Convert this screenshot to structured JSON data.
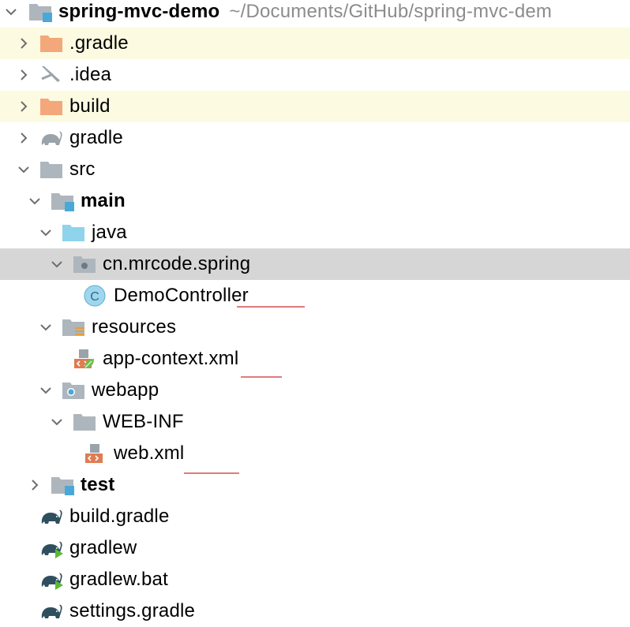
{
  "project": {
    "name": "spring-mvc-demo",
    "path": "~/Documents/GitHub/spring-mvc-dem"
  },
  "tree": {
    "gradle_dir": ".gradle",
    "idea_dir": ".idea",
    "build_dir": "build",
    "gradle_folder": "gradle",
    "src": "src",
    "main": "main",
    "java": "java",
    "package": "cn.mrcode.spring",
    "demo_controller": "DemoController",
    "resources": "resources",
    "app_context": "app-context.xml",
    "webapp": "webapp",
    "web_inf": "WEB-INF",
    "web_xml": "web.xml",
    "test": "test",
    "build_gradle": "build.gradle",
    "gradlew": "gradlew",
    "gradlew_bat": "gradlew.bat",
    "settings_gradle": "settings.gradle"
  },
  "icons": {
    "folder_excluded": "folder-orange",
    "folder_plain": "folder-gray",
    "source_root": "folder-blue",
    "class": "class-c-icon",
    "gradle": "elephant-icon"
  },
  "colors": {
    "excluded_folder": "#f4a77a",
    "folder": "#aeb6bd",
    "source_folder": "#8fd3ec",
    "row_highlight": "#fcfbe2",
    "row_selected": "#d6d6d6",
    "squiggle": "#e07b7b",
    "elephant": "#2f4f5e"
  },
  "icon_glyphs": {
    "class_letter": "C"
  }
}
